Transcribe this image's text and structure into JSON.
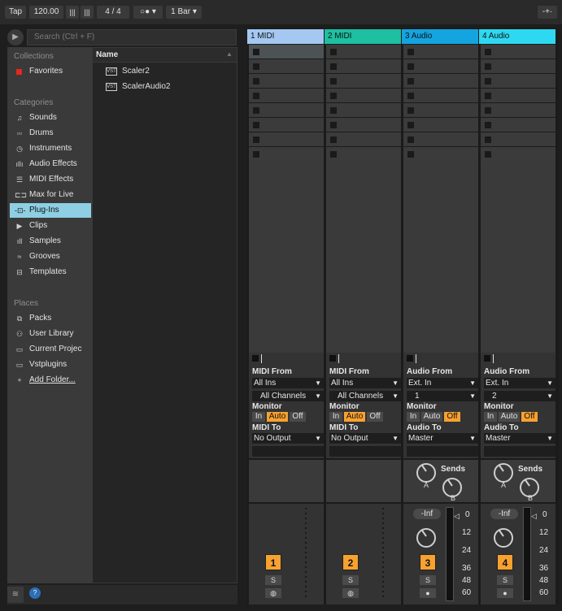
{
  "topbar": {
    "tap": "Tap",
    "tempo": "120.00",
    "signature": "4  /  4",
    "quantize": "1 Bar"
  },
  "browser": {
    "search_placeholder": "Search (Ctrl + F)",
    "collections_head": "Collections",
    "favorites": "Favorites",
    "categories_head": "Categories",
    "categories": [
      "Sounds",
      "Drums",
      "Instruments",
      "Audio Effects",
      "MIDI Effects",
      "Max for Live",
      "Plug-Ins",
      "Clips",
      "Samples",
      "Grooves",
      "Templates"
    ],
    "places_head": "Places",
    "places": [
      "Packs",
      "User Library",
      "Current Projec",
      "Vstplugins",
      "Add Folder..."
    ],
    "name_col": "Name",
    "files": [
      "Scaler2",
      "ScalerAudio2"
    ]
  },
  "tracks": [
    {
      "name": "1 MIDI",
      "color": "#a4c8f2",
      "from_label": "MIDI From",
      "from": "All Ins",
      "from2": "All Channels",
      "monitor_label": "Monitor",
      "monitor": [
        "In",
        "Auto",
        "Off"
      ],
      "to_label": "MIDI To",
      "to": "No Output",
      "number": "1",
      "solo": "S"
    },
    {
      "name": "2 MIDI",
      "color": "#1dc0a0",
      "from_label": "MIDI From",
      "from": "All Ins",
      "from2": "All Channels",
      "monitor_label": "Monitor",
      "monitor": [
        "In",
        "Auto",
        "Off"
      ],
      "to_label": "MIDI To",
      "to": "No Output",
      "number": "2",
      "solo": "S"
    },
    {
      "name": "3 Audio",
      "color": "#14a4e0",
      "from_label": "Audio From",
      "from": "Ext. In",
      "from2": "1",
      "monitor_label": "Monitor",
      "monitor": [
        "In",
        "Auto",
        "Off"
      ],
      "to_label": "Audio To",
      "to": "Master",
      "number": "3",
      "solo": "S",
      "sends": "Sends",
      "send_a": "A",
      "send_b": "B",
      "volume": "-Inf"
    },
    {
      "name": "4 Audio",
      "color": "#2ed8f0",
      "from_label": "Audio From",
      "from": "Ext. In",
      "from2": "2",
      "monitor_label": "Monitor",
      "monitor": [
        "In",
        "Auto",
        "Off"
      ],
      "to_label": "Audio To",
      "to": "Master",
      "number": "4",
      "solo": "S",
      "sends": "Sends",
      "send_a": "A",
      "send_b": "B",
      "volume": "-Inf"
    }
  ],
  "meter_scale": [
    "0",
    "12",
    "24",
    "36",
    "48",
    "60"
  ],
  "colors": {
    "accent": "#f7a130",
    "selection": "#8ecfe3"
  }
}
